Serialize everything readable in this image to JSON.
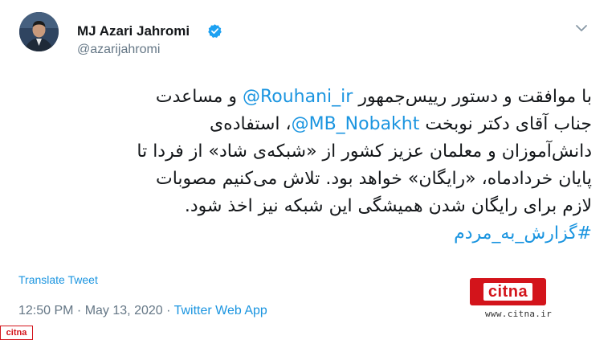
{
  "author": {
    "display_name": "MJ Azari Jahromi",
    "handle": "@azarijahromi",
    "verified": true
  },
  "tweet": {
    "lines": [
      [
        {
          "t": "text",
          "v": "با موافقت و دستور رییس‌جمهور "
        },
        {
          "t": "mention",
          "v": "@Rouhani_ir"
        },
        {
          "t": "text",
          "v": " و مساعدت"
        }
      ],
      [
        {
          "t": "text",
          "v": "جناب آقای دکتر نوبخت "
        },
        {
          "t": "mention",
          "v": "@MB_Nobakht"
        },
        {
          "t": "text",
          "v": "، استفاده‌ی"
        }
      ],
      [
        {
          "t": "text",
          "v": "دانش‌آموزان و معلمان عزیز کشور از «شبکه‌ی شاد» از فردا تا"
        }
      ],
      [
        {
          "t": "text",
          "v": "پایان خردادماه، «رایگان» خواهد بود. تلاش می‌کنیم مصوبات"
        }
      ],
      [
        {
          "t": "text",
          "v": "لازم برای رایگان شدن همیشگی این شبکه نیز اخذ شود."
        }
      ],
      [
        {
          "t": "hashtag",
          "v": "#گزارش_به_مردم"
        }
      ]
    ]
  },
  "translate_label": "Translate Tweet",
  "meta": {
    "time": "12:50 PM",
    "separator": " · ",
    "date": "May 13, 2020",
    "source": "Twitter Web App"
  },
  "watermark": {
    "logo_text": "citna",
    "url": "www.citna.ir"
  },
  "icons": {
    "verified": "verified-badge-icon",
    "caret": "chevron-down-icon"
  },
  "colors": {
    "link": "#1b95e0",
    "text": "#14171a",
    "muted": "#657786",
    "citna_red": "#d3141b"
  }
}
